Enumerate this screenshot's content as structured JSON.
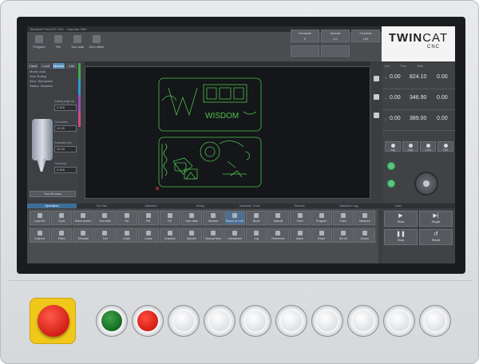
{
  "window": {
    "title": "Beckhoff TwinCAT CNC - Operator HMI"
  },
  "toolbar": {
    "buttons": [
      {
        "label": "Program"
      },
      {
        "label": "File"
      },
      {
        "label": "Tool data"
      },
      {
        "label": "Zero offset"
      }
    ],
    "status": [
      {
        "label": "Feedrate",
        "value": "0"
      },
      {
        "label": "Spindle",
        "value": "0.0"
      },
      {
        "label": "Override",
        "value": "100"
      }
    ]
  },
  "logo": {
    "brand_bold": "TWIN",
    "brand_thin": "CAT",
    "sub": "CNC"
  },
  "left_panel": {
    "tabs": [
      "Used",
      "Load",
      "Monitor",
      "Cali"
    ],
    "rows": [
      "Mode: Auto",
      "Tool: Ruling",
      "Zero: Workpiece",
      "Status: Disabled"
    ],
    "tool_fields": [
      {
        "label": "Cutting edge len",
        "value": "0.000"
      },
      {
        "label": "Tool radius",
        "value": "10.00"
      },
      {
        "label": "Protrusion len",
        "value": "20.00"
      },
      {
        "label": "Tool wear",
        "value": "0.000"
      }
    ],
    "footer": "Tool Browse"
  },
  "axes": {
    "headers": [
      "Act",
      "Pos",
      "Dist"
    ],
    "rows": [
      {
        "axis": "X",
        "pos": "0.00",
        "act": "824.10",
        "dist": "0.00"
      },
      {
        "axis": "Y",
        "pos": "0.00",
        "act": "346.90",
        "dist": "0.00"
      },
      {
        "axis": "Z",
        "pos": "0.00",
        "act": "389.00",
        "dist": "0.00"
      }
    ]
  },
  "right_buttons": [
    "Jog",
    "Step",
    "Cont",
    "Ref"
  ],
  "ribbon_tabs": [
    "Operation",
    "Tool list",
    "Machine",
    "Setup",
    "Machine Tools",
    "Service",
    "Machine Log",
    "User"
  ],
  "ribbon_row1": [
    "Load NC",
    "Cycle",
    "Block search",
    "Tool data",
    "TM",
    "PM",
    "PS",
    "User data",
    "Window",
    "Return to cont.",
    "Block",
    "Manual",
    "Feed",
    "Program",
    "Trace",
    "Measure"
  ],
  "ribbon_row2": [
    "Explorer",
    "Editor",
    "Simulate",
    "Tool",
    "Limits",
    "Loads",
    "Graphics",
    "Spindle",
    "Manual feed",
    "Handwheel",
    "Jog",
    "Reference",
    "Alarm",
    "Reset",
    "Set ref",
    "Dryrun"
  ],
  "run_buttons": [
    "Start",
    "Single",
    "Stop",
    "Reset"
  ],
  "canvas": {
    "text": "WISDOM"
  }
}
